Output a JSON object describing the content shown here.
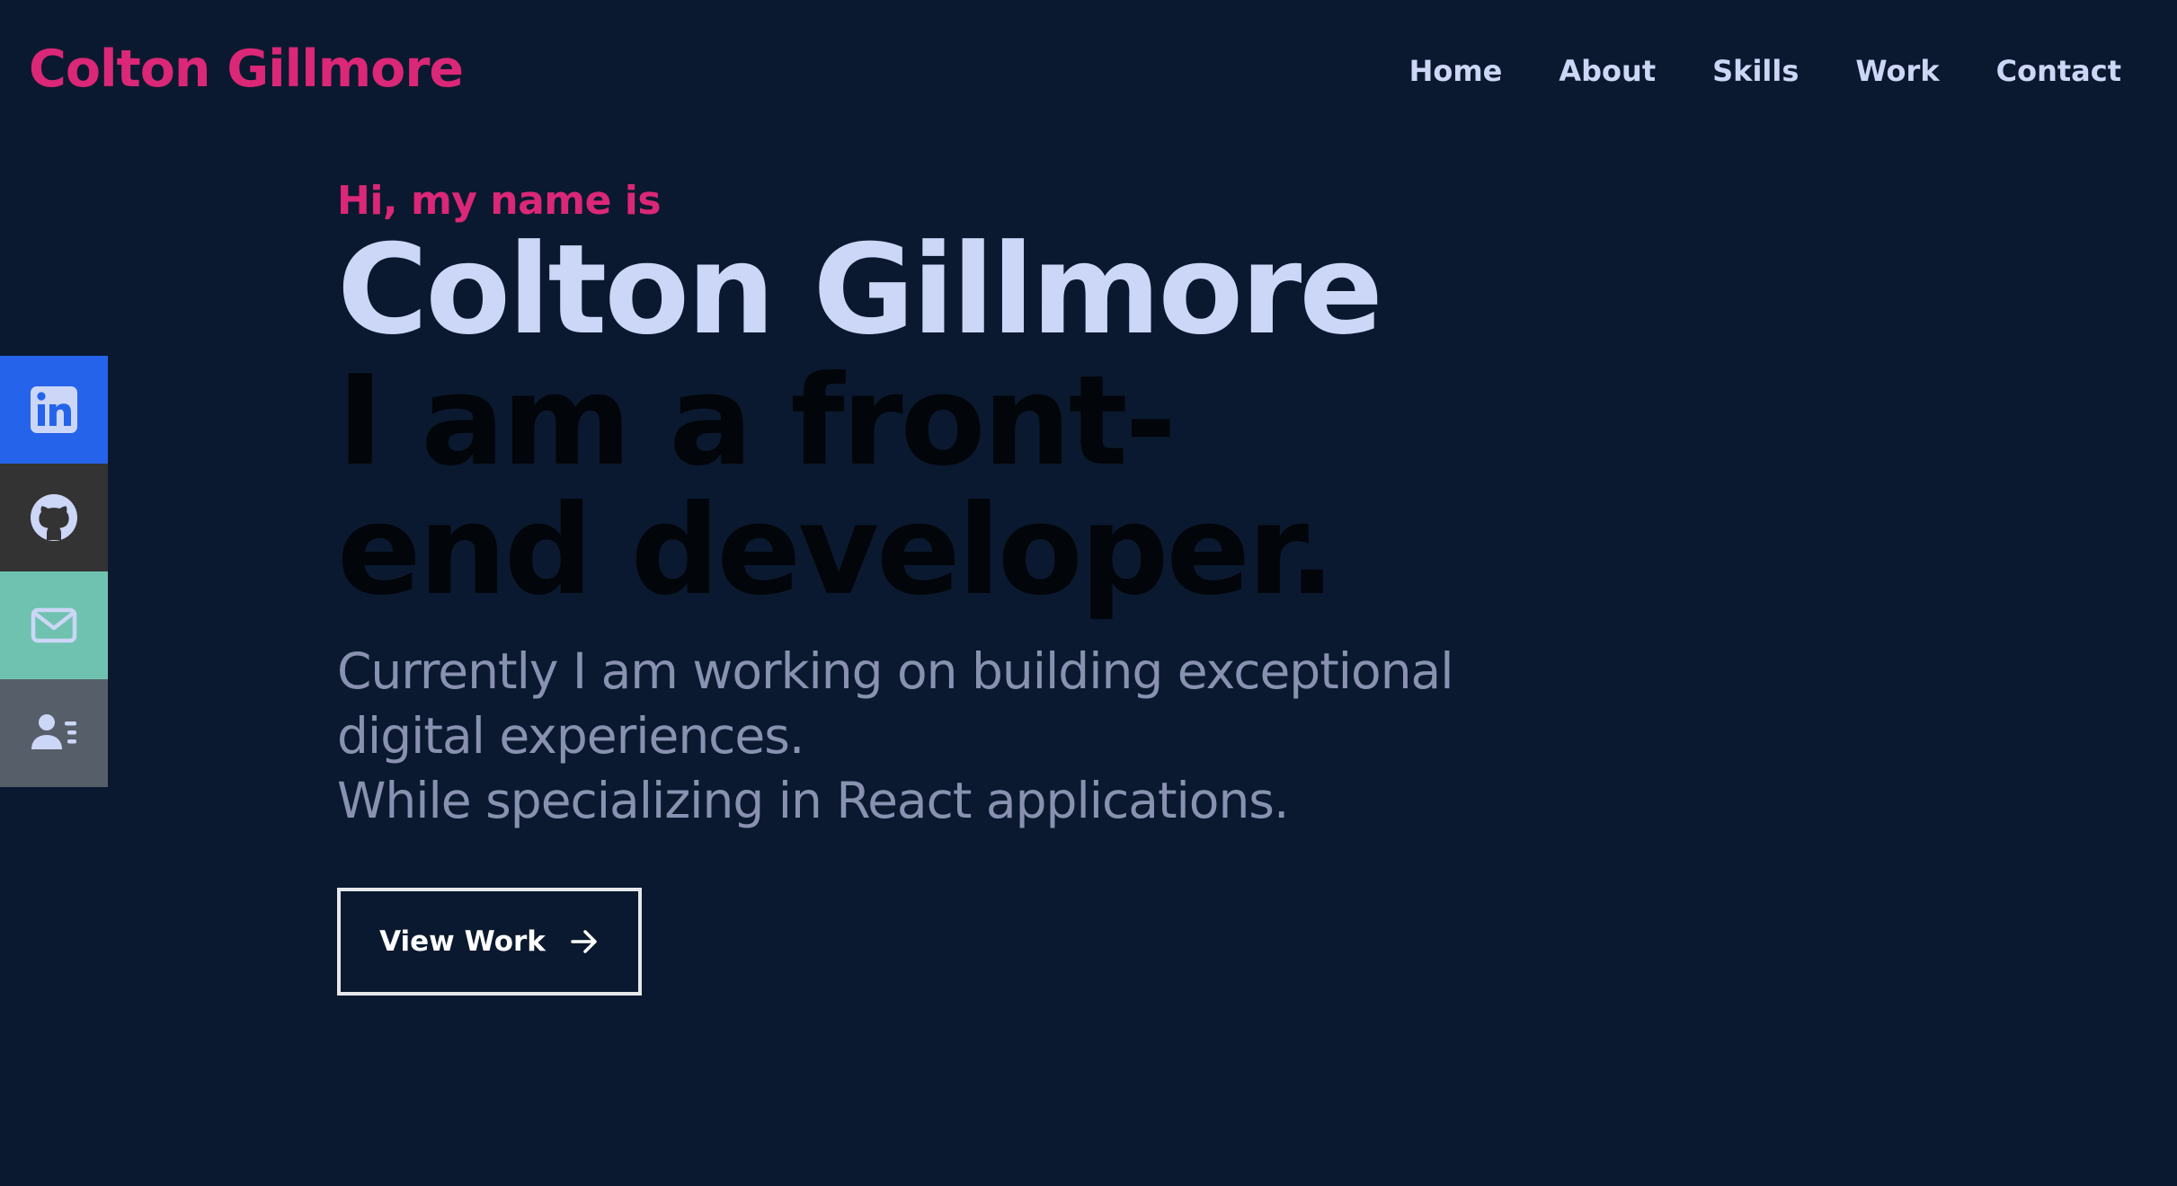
{
  "header": {
    "logo": "Colton Gillmore",
    "nav": [
      "Home",
      "About",
      "Skills",
      "Work",
      "Contact"
    ]
  },
  "social": [
    {
      "icon": "linkedin-icon",
      "color": "#2563eb"
    },
    {
      "icon": "github-icon",
      "color": "#333333"
    },
    {
      "icon": "mail-icon",
      "color": "#6fc2b0"
    },
    {
      "icon": "resume-icon",
      "color": "#565f69"
    }
  ],
  "hero": {
    "greeting": "Hi, my name is",
    "name": "Colton Gillmore",
    "role": "I am a front-end developer.",
    "desc_line1": "Currently I am working on building exceptional digital experiences.",
    "desc_line2": "While specializing in React applications.",
    "cta": "View Work"
  },
  "colors": {
    "background": "#0a192f",
    "accent": "#db2777",
    "heading": "#ccd6f6",
    "text": "#8892b0"
  }
}
